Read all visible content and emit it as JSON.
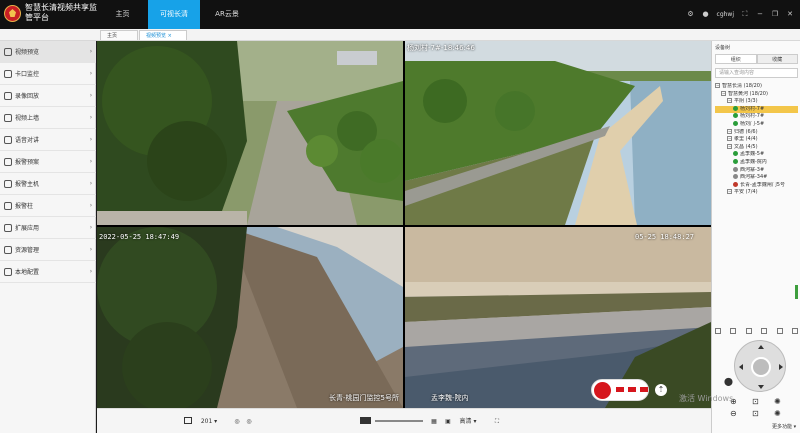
{
  "app": {
    "title": "智慧长清视频共享监管平台"
  },
  "nav": {
    "tabs": [
      {
        "label": "主页"
      },
      {
        "label": "可视长清"
      },
      {
        "label": "AR云景"
      }
    ]
  },
  "topbar": {
    "user": "cghwj"
  },
  "subtabs": [
    {
      "label": "主页"
    },
    {
      "label": "视频预览"
    }
  ],
  "sidebar": {
    "items": [
      {
        "label": "视频预览",
        "icon": "video-icon"
      },
      {
        "label": "卡口监控",
        "icon": "checkpoint-icon"
      },
      {
        "label": "录像回放",
        "icon": "playback-icon"
      },
      {
        "label": "视频上墙",
        "icon": "wall-icon"
      },
      {
        "label": "语音对讲",
        "icon": "intercom-icon"
      },
      {
        "label": "报警预案",
        "icon": "alarm-plan-icon"
      },
      {
        "label": "报警主机",
        "icon": "alarm-host-icon"
      },
      {
        "label": "报警柱",
        "icon": "alarm-pillar-icon"
      },
      {
        "label": "扩展应用",
        "icon": "extension-icon"
      },
      {
        "label": "资源管理",
        "icon": "resource-icon"
      },
      {
        "label": "本地配置",
        "icon": "settings-icon"
      }
    ]
  },
  "cameras": [
    {
      "timestamp": "",
      "name": ""
    },
    {
      "timestamp": "",
      "name": "杨刘村-7#-18:46:46"
    },
    {
      "timestamp": "2022-05-25 18:47:49",
      "name": "长青-桃园门监控5号所"
    },
    {
      "timestamp": "05-25 18:48:27",
      "name": "孟李魏-院内"
    }
  ],
  "bottombar": {
    "channel_label": "201",
    "stream_label": "高清"
  },
  "rightpanel": {
    "title": "设备树",
    "tabs": [
      {
        "label": "组织"
      },
      {
        "label": "收藏"
      }
    ],
    "search_placeholder": "请输入查询内容",
    "tree": [
      {
        "label": "智慧长清 (18/20)"
      },
      {
        "label": "智慧黄河 (18/20)"
      },
      {
        "label": "平阴 (3/3)"
      },
      {
        "label": "杨刘村-7#"
      },
      {
        "label": "杨刘村-7#"
      },
      {
        "label": "杨刘门-5#"
      },
      {
        "label": "归德 (6/6)"
      },
      {
        "label": "孝里 (4/4)"
      },
      {
        "label": "文昌 (4/5)"
      },
      {
        "label": "孟李魏-5#"
      },
      {
        "label": "孟李魏-院内"
      },
      {
        "label": "西河寨-3#"
      },
      {
        "label": "西河寨-34#"
      },
      {
        "label": "长青-孟李魏闸门5号"
      },
      {
        "label": "平安 (7/4)"
      }
    ],
    "more_label": "更多功能"
  },
  "watermark": "激活 Windows"
}
